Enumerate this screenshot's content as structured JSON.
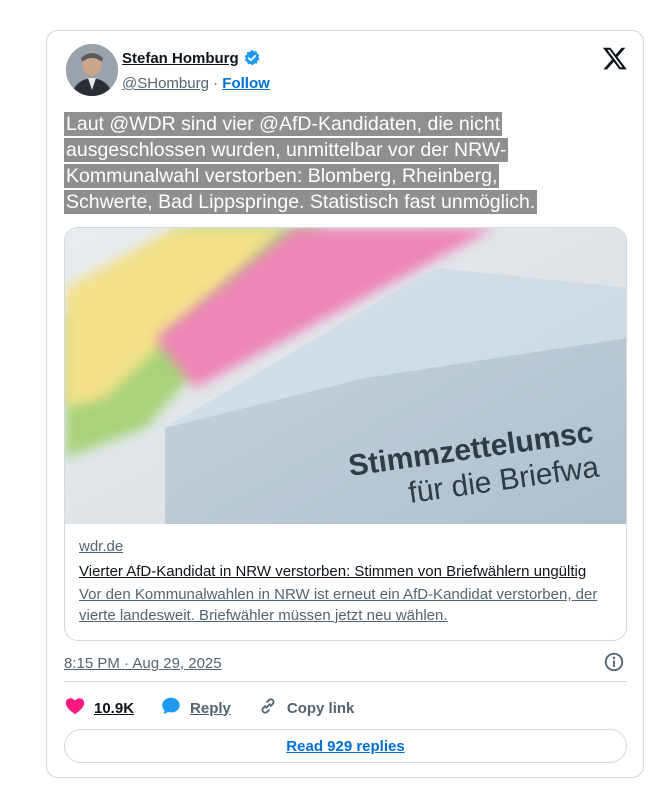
{
  "author": {
    "name": "Stefan Homburg",
    "handle": "@SHomburg",
    "separator": "·",
    "follow_label": "Follow"
  },
  "tweet": {
    "lines": [
      "Laut @WDR sind vier @AfD-Kandidaten, die nicht",
      "ausgeschlossen wurden, unmittelbar vor der NRW-",
      "Kommunalwahl verstorben: Blomberg, Rheinberg,",
      "Schwerte, Bad Lippspringe. Statistisch fast unmöglich."
    ],
    "timestamp": "8:15 PM · Aug 29, 2025"
  },
  "link_card": {
    "image_text_line1": "Stimmzettelumsc",
    "image_text_line2": "für die Briefwa",
    "domain": "wdr.de",
    "title": "Vierter AfD-Kandidat in NRW verstorben: Stimmen von Briefwählern ungültig",
    "description": "Vor den Kommunalwahlen in NRW ist erneut ein AfD-Kandidat verstorben, der vierte landesweit. Briefwähler müssen jetzt neu wählen."
  },
  "actions": {
    "like_count": "10.9K",
    "reply_label": "Reply",
    "copy_label": "Copy link"
  },
  "replies_button_label": "Read 929 replies",
  "colors": {
    "accent": "#006fd6",
    "like": "#f91880",
    "verified": "#1d9bf0",
    "highlight": "#8f8f8f"
  },
  "icons": [
    "x-logo-icon",
    "verified-badge-icon",
    "info-icon",
    "heart-icon",
    "reply-icon",
    "link-icon"
  ]
}
